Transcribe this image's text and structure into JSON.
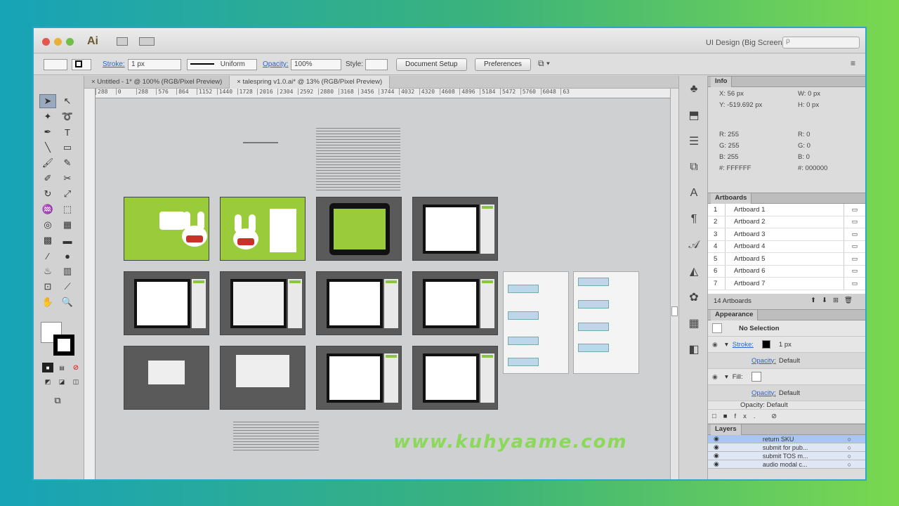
{
  "app": {
    "logo": "Ai",
    "workspace": "UI Design (Big Screen) ▾",
    "search_placeholder": "ρ"
  },
  "control_bar": {
    "stroke_label": "Stroke:",
    "stroke_value": "1 px",
    "stroke_style": "Uniform",
    "opacity_label": "Opacity:",
    "opacity_value": "100%",
    "style_label": "Style:",
    "doc_setup": "Document Setup",
    "preferences": "Preferences"
  },
  "tabs": [
    {
      "label": "Untitled - 1* @ 100% (RGB/Pixel Preview)"
    },
    {
      "label": "talespring v1.0.ai* @ 13% (RGB/Pixel Preview)"
    }
  ],
  "ruler_ticks": [
    "288",
    "0",
    "288",
    "576",
    "864",
    "1152",
    "1440",
    "1728",
    "2016",
    "2304",
    "2592",
    "2880",
    "3168",
    "3456",
    "3744",
    "4032",
    "4320",
    "4608",
    "4896",
    "5184",
    "5472",
    "5760",
    "6048",
    "63"
  ],
  "info": {
    "title": "Info",
    "x": "X: 56 px",
    "y": "Y: -519.692 px",
    "w": "W: 0 px",
    "h": "H: 0 px",
    "r1": "R: 255",
    "g1": "G: 255",
    "b1": "B: 255",
    "hex1": "#: FFFFFF",
    "r2": "R: 0",
    "g2": "G: 0",
    "b2": "B: 0",
    "hex2": "#: 000000"
  },
  "artboards": {
    "title": "Artboards",
    "items": [
      {
        "num": "1",
        "name": "Artboard 1"
      },
      {
        "num": "2",
        "name": "Artboard 2"
      },
      {
        "num": "3",
        "name": "Artboard 3"
      },
      {
        "num": "4",
        "name": "Artboard 4"
      },
      {
        "num": "5",
        "name": "Artboard 5"
      },
      {
        "num": "6",
        "name": "Artboard 6"
      },
      {
        "num": "7",
        "name": "Artboard 7"
      }
    ],
    "count": "14 Artboards"
  },
  "appearance": {
    "title": "Appearance",
    "selection": "No Selection",
    "stroke_label": "Stroke:",
    "stroke_value": "1 px",
    "opacity_label": "Opacity:",
    "opacity_value": "Default",
    "fill_label": "Fill:",
    "opacity2_label": "Opacity:",
    "opacity2_value": "Default",
    "opacity3": "Opacity: Default"
  },
  "layers": {
    "title": "Layers",
    "items": [
      {
        "name": "return SKU"
      },
      {
        "name": "submit for pub..."
      },
      {
        "name": "submit TOS m..."
      },
      {
        "name": "audio modal c..."
      }
    ]
  },
  "watermark": "www.kuhyaame.com"
}
